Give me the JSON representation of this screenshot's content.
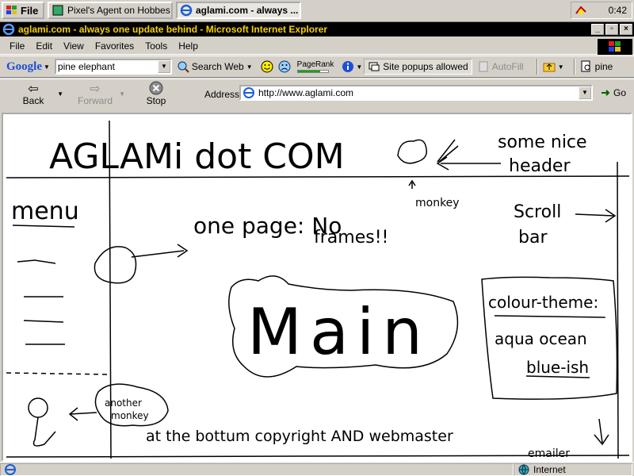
{
  "taskbar": {
    "start_label": "File",
    "tasks": [
      {
        "label": "Pixel's Agent on Hobbes - [..."
      },
      {
        "label": "aglami.com - always ..."
      }
    ],
    "clock": "0:42"
  },
  "window": {
    "title": "aglami.com - always one update behind - Microsoft Internet Explorer"
  },
  "menu": [
    "File",
    "Edit",
    "View",
    "Favorites",
    "Tools",
    "Help"
  ],
  "google_toolbar": {
    "logo": "Google",
    "search_value": "pine elephant",
    "search_web_label": "Search Web",
    "pagerank_label": "PageRank",
    "pagerank_level": 0.75,
    "popups_label": "Site popups allowed",
    "autofill_label": "AutoFill",
    "highlight_term": "pine"
  },
  "nav": {
    "back_label": "Back",
    "forward_label": "Forward",
    "stop_label": "Stop"
  },
  "address": {
    "label": "Address",
    "url": "http://www.aglami.com",
    "go_label": "Go"
  },
  "sketch": {
    "site_title": "AGLAMi dot COM",
    "header_note_1": "some nice",
    "header_note_2": "header",
    "monkey_note": "monkey",
    "menu_label": "menu",
    "one_page_1": "one page: No",
    "one_page_2": "frames!!",
    "scroll_note_1": "Scroll",
    "scroll_note_2": "bar",
    "main_label": "Main",
    "colour_1": "colour-theme:",
    "colour_2": "aqua ocean",
    "colour_3": "blue-ish",
    "another_monkey_1": "another",
    "another_monkey_2": "monkey",
    "footer_note": "at the bottum copyright AND webmaster",
    "emailer_note": "emailer"
  },
  "status": {
    "text": "",
    "zone": "Internet"
  }
}
